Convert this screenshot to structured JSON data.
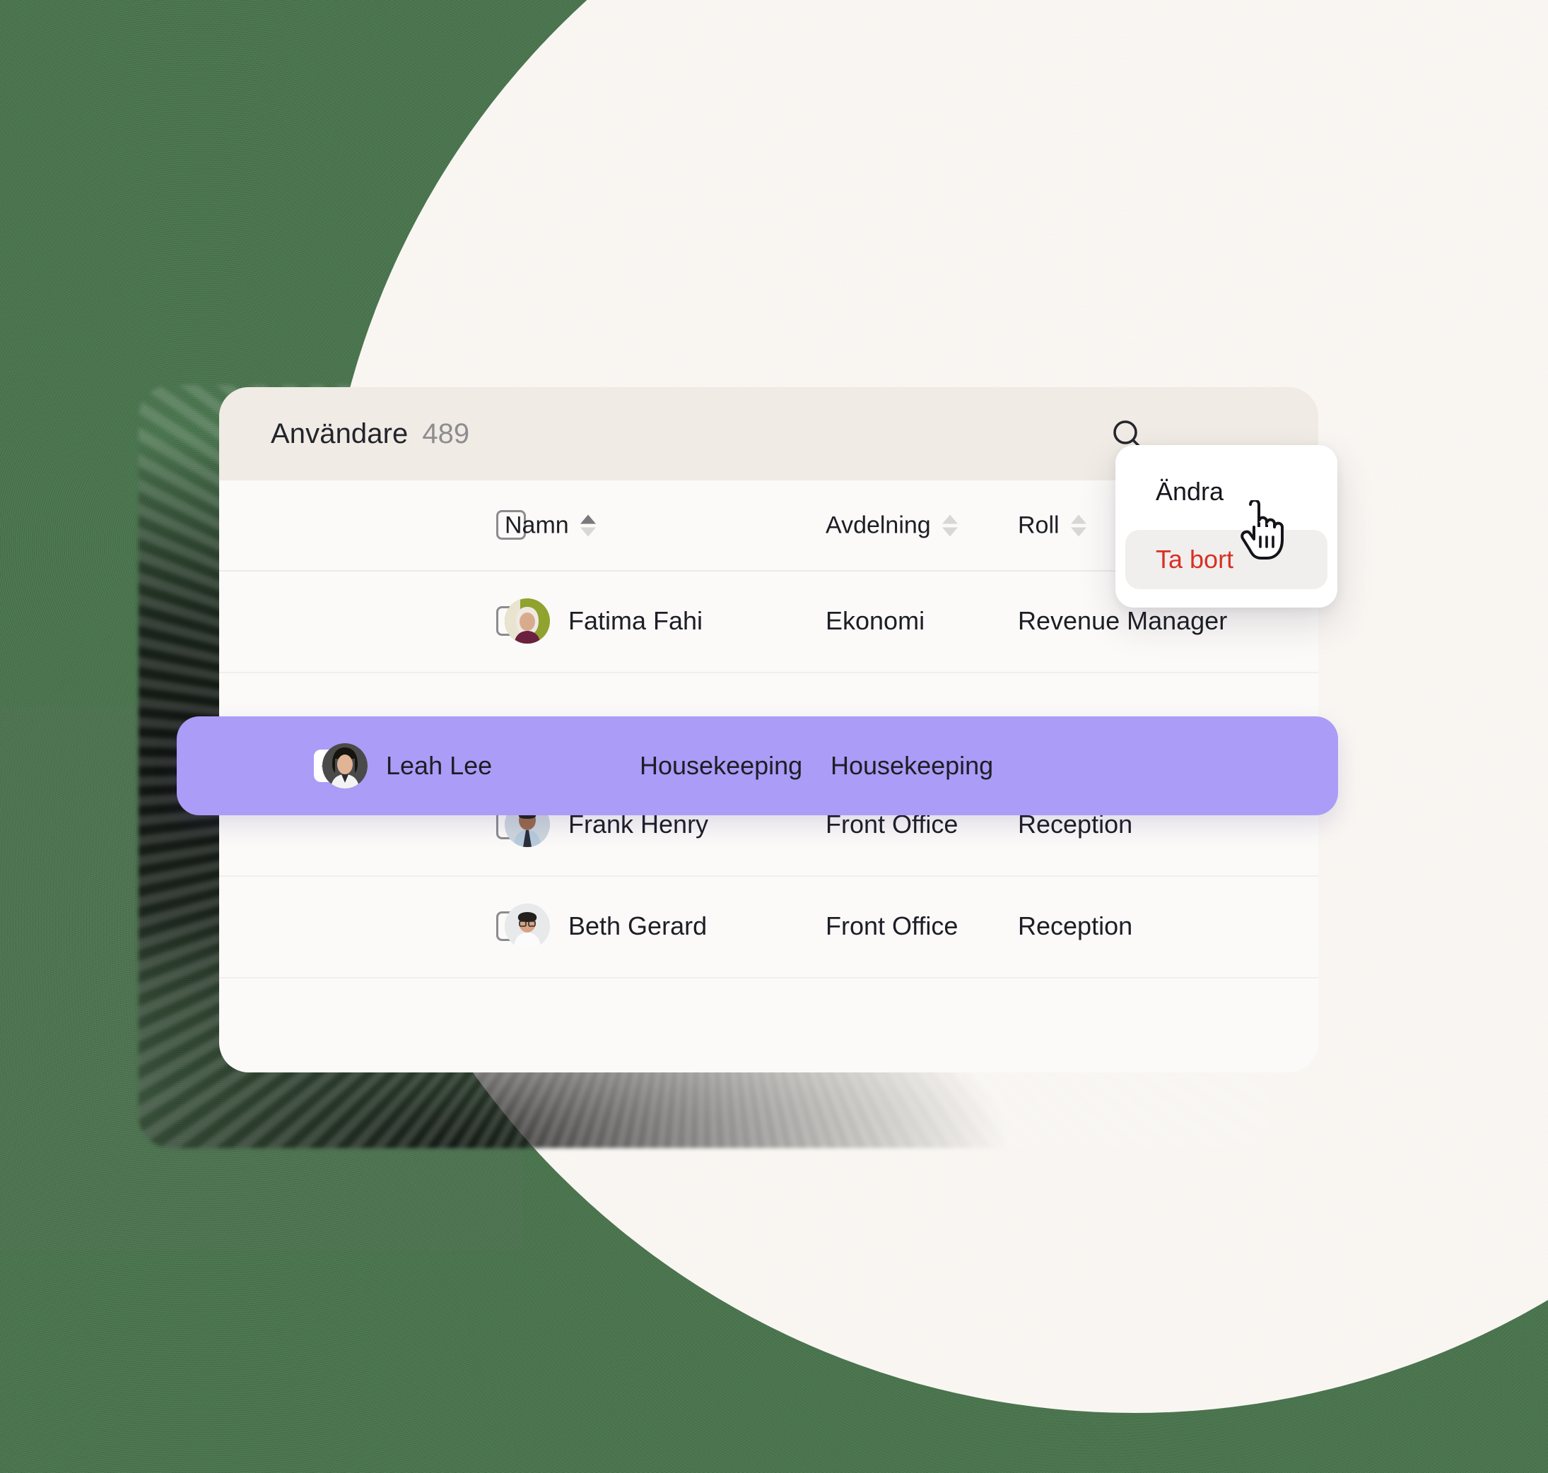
{
  "background": {
    "green": "#49724d",
    "cream": "#f9f6f2"
  },
  "card": {
    "header": {
      "title": "Användare",
      "count": "489",
      "search_icon": "search-icon"
    },
    "table": {
      "columns": [
        {
          "label": "Namn",
          "sortable": true,
          "sort_state": "asc"
        },
        {
          "label": "Avdelning",
          "sortable": true,
          "sort_state": "none"
        },
        {
          "label": "Roll",
          "sortable": true,
          "sort_state": "none"
        }
      ],
      "select_all_checked": false,
      "rows": [
        {
          "name": "Fatima Fahi",
          "department": "Ekonomi",
          "role": "Revenue Manager",
          "selected": false,
          "avatar": "avatar-fatima"
        },
        {
          "name": "Leah Lee",
          "department": "Housekeeping",
          "role": "Housekeeping",
          "selected": true,
          "avatar": "avatar-leah"
        },
        {
          "name": "Frank Henry",
          "department": "Front Office",
          "role": "Reception",
          "selected": false,
          "avatar": "avatar-frank"
        },
        {
          "name": "Beth Gerard",
          "department": "Front Office",
          "role": "Reception",
          "selected": false,
          "avatar": "avatar-beth"
        }
      ]
    }
  },
  "context_menu": {
    "items": [
      {
        "label": "Ändra",
        "color": "#16171d",
        "hovered": false
      },
      {
        "label": "Ta bort",
        "color": "#d93025",
        "hovered": true
      }
    ]
  },
  "colors": {
    "selected_row": "#ab9cf7",
    "danger": "#d93025",
    "header_bg": "#f0ebe4",
    "card_bg": "#fbfaf8"
  }
}
